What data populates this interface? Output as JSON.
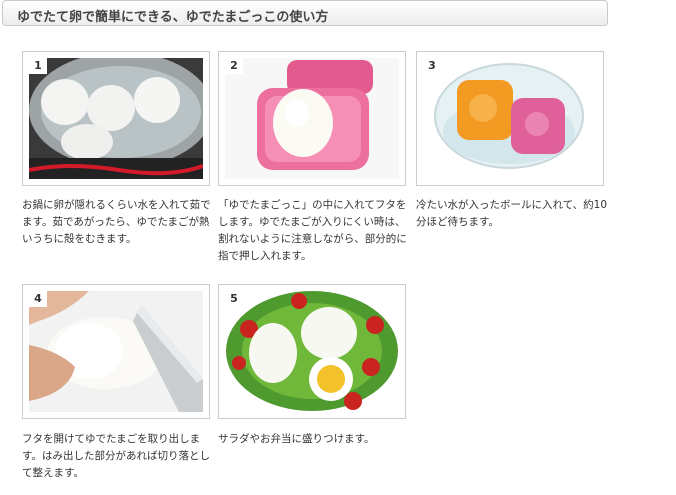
{
  "page": {
    "title": "ゆでたて卵で簡単にできる、ゆでたまごっこの使い方"
  },
  "steps": [
    {
      "number": "1",
      "text": "お鍋に卵が隠れるくらい水を入れて茹でます。茹であがったら、ゆでたまごが熱いうちに殻をむきます。"
    },
    {
      "number": "2",
      "text": "「ゆでたまごっこ」の中に入れてフタをします。ゆでたまごが入りにくい時は、割れないように注意しながら、部分的に指で押し入れます。"
    },
    {
      "number": "3",
      "text": "冷たい水が入ったボールに入れて、約10分ほど待ちます。"
    },
    {
      "number": "4",
      "text": "フタを開けてゆでたまごを取り出します。はみ出した部分があれば切り落として整えます。"
    },
    {
      "number": "5",
      "text": "サラダやお弁当に盛りつけます。"
    }
  ]
}
